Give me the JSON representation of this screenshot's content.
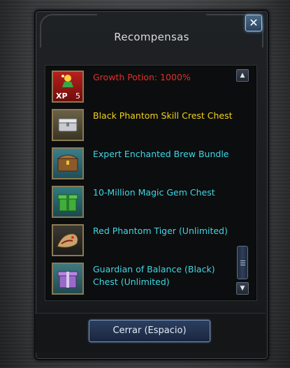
{
  "window": {
    "title": "Recompensas",
    "close_label": "✕",
    "button_label": "Cerrar (Espacio)"
  },
  "rewards": [
    {
      "name": "Growth Potion: 1000%",
      "color": "#e0302a",
      "icon": "growth-potion-icon",
      "icon_text": "XP",
      "icon_count": "5"
    },
    {
      "name": "Black Phantom Skill Crest Chest",
      "color": "#f2d21c",
      "icon": "silver-chest-icon"
    },
    {
      "name": "Expert Enchanted Brew Bundle",
      "color": "#3fd7e6",
      "icon": "brew-chest-icon"
    },
    {
      "name": "10-Million Magic Gem Chest",
      "color": "#3fd7e6",
      "icon": "green-gift-box-icon"
    },
    {
      "name": "Red Phantom Tiger (Unlimited)",
      "color": "#3fd7e6",
      "icon": "phantom-tiger-icon"
    },
    {
      "name": "Guardian of Balance (Black) Chest (Unlimited)",
      "color": "#3fd7e6",
      "icon": "purple-gift-box-icon"
    }
  ]
}
